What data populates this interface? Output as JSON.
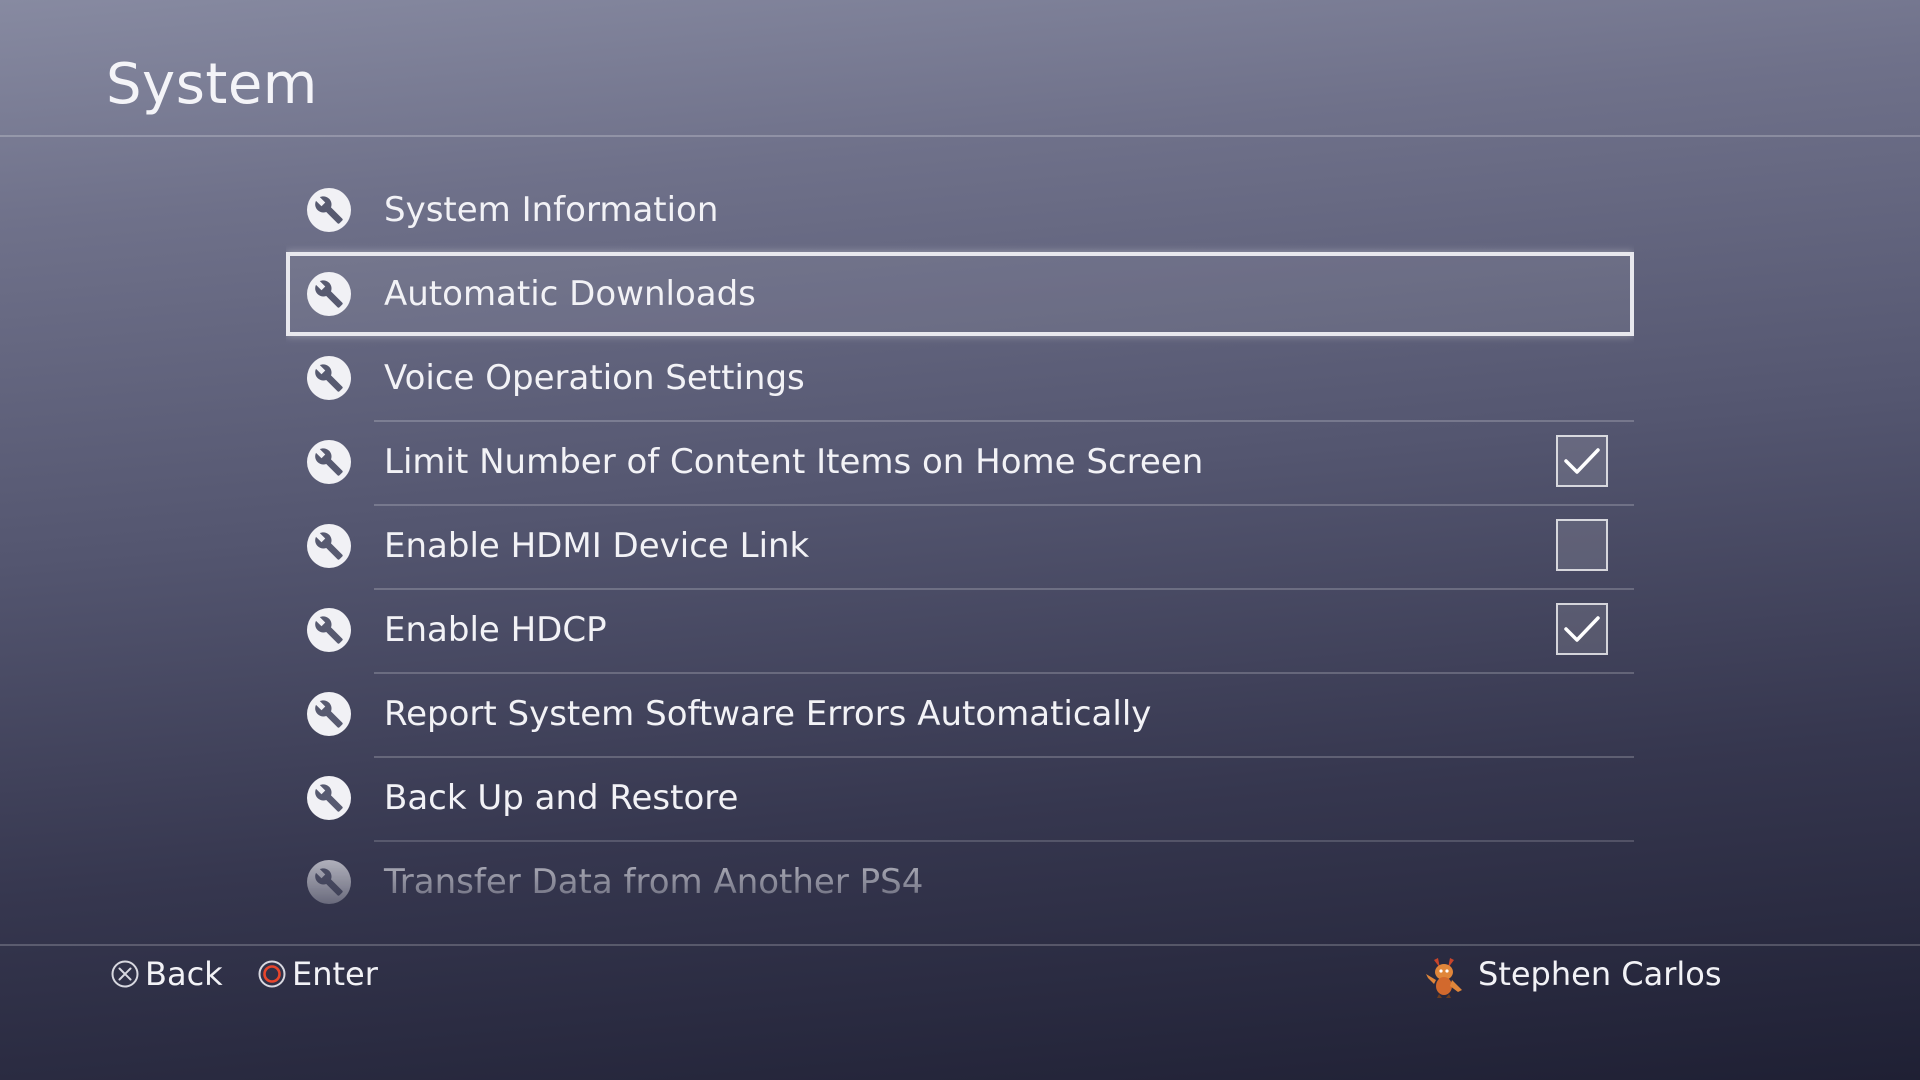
{
  "header": {
    "title": "System"
  },
  "menu": {
    "items": [
      {
        "label": "System Information",
        "icon": "wrench-icon",
        "checkbox": null,
        "selected": false
      },
      {
        "label": "Automatic Downloads",
        "icon": "wrench-icon",
        "checkbox": null,
        "selected": true
      },
      {
        "label": "Voice Operation Settings",
        "icon": "wrench-icon",
        "checkbox": null,
        "selected": false
      },
      {
        "label": "Limit Number of Content Items on Home Screen",
        "icon": "wrench-icon",
        "checkbox": true,
        "selected": false
      },
      {
        "label": "Enable HDMI Device Link",
        "icon": "wrench-icon",
        "checkbox": false,
        "selected": false
      },
      {
        "label": "Enable HDCP",
        "icon": "wrench-icon",
        "checkbox": true,
        "selected": false
      },
      {
        "label": "Report System Software Errors Automatically",
        "icon": "wrench-icon",
        "checkbox": null,
        "selected": false
      },
      {
        "label": "Back Up and Restore",
        "icon": "wrench-icon",
        "checkbox": null,
        "selected": false
      },
      {
        "label": "Transfer Data from Another PS4",
        "icon": "wrench-icon",
        "checkbox": null,
        "selected": false
      }
    ]
  },
  "footer": {
    "back_label": "Back",
    "back_icon": "cross-button-icon",
    "enter_label": "Enter",
    "enter_icon": "circle-button-icon",
    "user_name": "Stephen Carlos",
    "user_avatar": "avatar-icon"
  },
  "colors": {
    "circle_button": "#e8452c",
    "selection_border": "#e8e8ee",
    "text": "#f2f2f6"
  }
}
